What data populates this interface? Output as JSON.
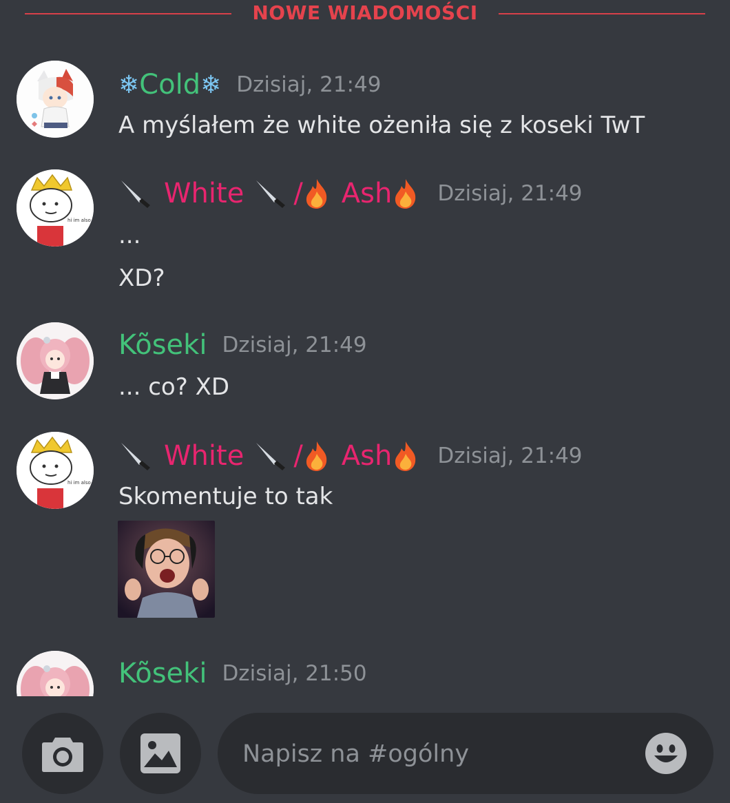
{
  "divider": {
    "label": "NOWE WIADOMOŚCI"
  },
  "messages": [
    {
      "author": "Cold",
      "timestamp": "Dzisiaj, 21:49",
      "lines": [
        "A myślałem że white ożeniła się z koseki TwT"
      ]
    },
    {
      "author_a": "White",
      "separator": "/",
      "author_b": "Ash",
      "timestamp": "Dzisiaj, 21:49",
      "lines": [
        "...",
        "XD?"
      ]
    },
    {
      "author": "Kõseki",
      "timestamp": "Dzisiaj, 21:49",
      "lines": [
        "... co? XD"
      ]
    },
    {
      "author_a": "White",
      "separator": "/",
      "author_b": "Ash",
      "timestamp": "Dzisiaj, 21:49",
      "lines": [
        "Skomentuje to tak"
      ]
    },
    {
      "author": "Kõseki",
      "timestamp": "Dzisiaj, 21:50"
    }
  ],
  "composer": {
    "placeholder": "Napisz na #ogólny"
  },
  "icons": {
    "camera": "camera-icon",
    "gallery": "image-icon",
    "emoji": "emoji-icon",
    "snowflake": "snowflake-icon",
    "knife": "knife-icon",
    "fire": "fire-icon"
  },
  "colors": {
    "background": "#36393f",
    "accent_red": "#e5434d",
    "name_green": "#43c27a",
    "name_pink": "#e8256f",
    "timestamp": "#8e9297"
  },
  "avatar_text": {
    "white_avatar_caption": "hi im also g"
  }
}
